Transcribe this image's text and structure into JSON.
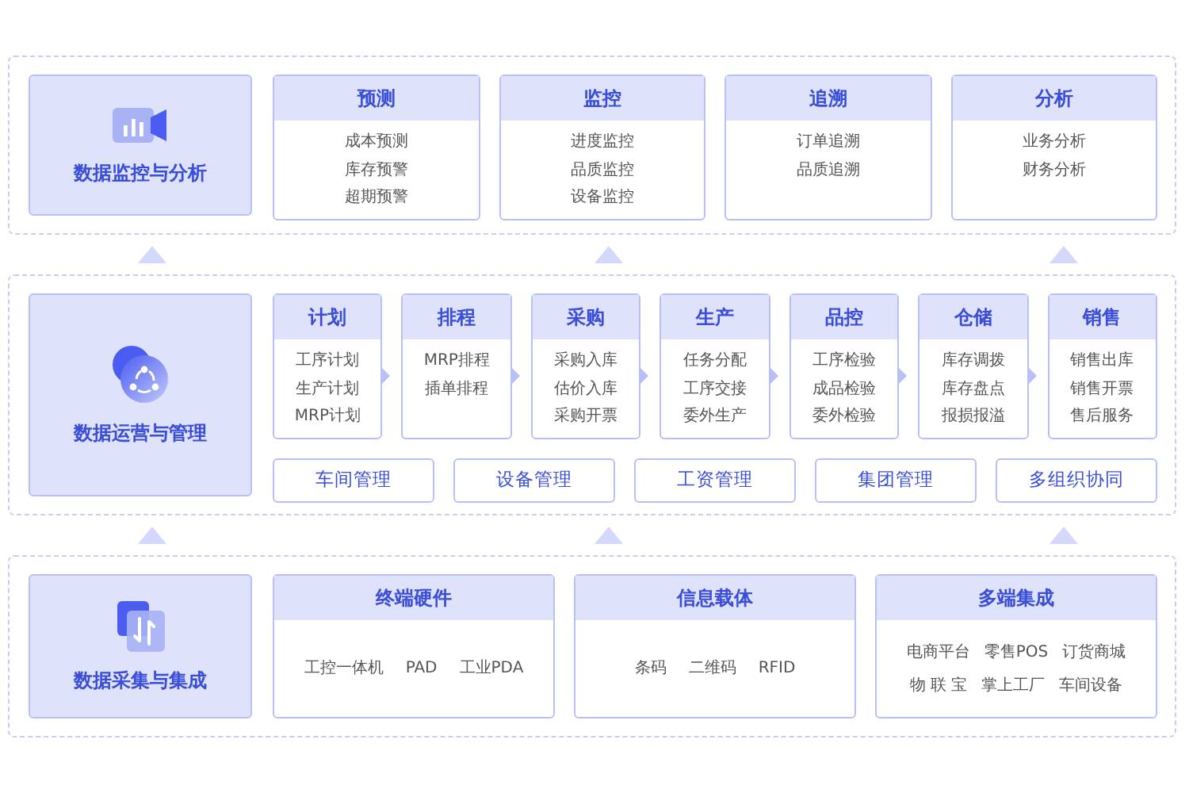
{
  "layers": [
    {
      "title": "数据监控与分析",
      "kind": "list",
      "flow": false,
      "modules": [
        {
          "title": "预测",
          "items": [
            "成本预测",
            "库存预警",
            "超期预警"
          ]
        },
        {
          "title": "监控",
          "items": [
            "进度监控",
            "品质监控",
            "设备监控"
          ]
        },
        {
          "title": "追溯",
          "items": [
            "订单追溯",
            "品质追溯"
          ]
        },
        {
          "title": "分析",
          "items": [
            "业务分析",
            "财务分析"
          ]
        }
      ]
    },
    {
      "title": "数据运营与管理",
      "kind": "list",
      "flow": true,
      "modules": [
        {
          "title": "计划",
          "items": [
            "工序计划",
            "生产计划",
            "MRP计划"
          ]
        },
        {
          "title": "排程",
          "items": [
            "MRP排程",
            "插单排程"
          ]
        },
        {
          "title": "采购",
          "items": [
            "采购入库",
            "估价入库",
            "采购开票"
          ]
        },
        {
          "title": "生产",
          "items": [
            "任务分配",
            "工序交接",
            "委外生产"
          ]
        },
        {
          "title": "品控",
          "items": [
            "工序检验",
            "成品检验",
            "委外检验"
          ]
        },
        {
          "title": "仓储",
          "items": [
            "库存调拨",
            "库存盘点",
            "报损报溢"
          ]
        },
        {
          "title": "销售",
          "items": [
            "销售出库",
            "销售开票",
            "售后服务"
          ]
        }
      ],
      "links": [
        "车间管理",
        "设备管理",
        "工资管理",
        "集团管理",
        "多组织协同"
      ]
    },
    {
      "title": "数据采集与集成",
      "kind": "inline",
      "flow": false,
      "modules": [
        {
          "title": "终端硬件",
          "items": [
            "工控一体机",
            "PAD",
            "工业PDA"
          ]
        },
        {
          "title": "信息载体",
          "items": [
            "条码",
            "二维码",
            "RFID"
          ]
        },
        {
          "title": "多端集成",
          "items": [
            "电商平台",
            "零售POS",
            "订货商城",
            "物 联 宝",
            "掌上工厂",
            "车间设备"
          ]
        }
      ]
    }
  ]
}
